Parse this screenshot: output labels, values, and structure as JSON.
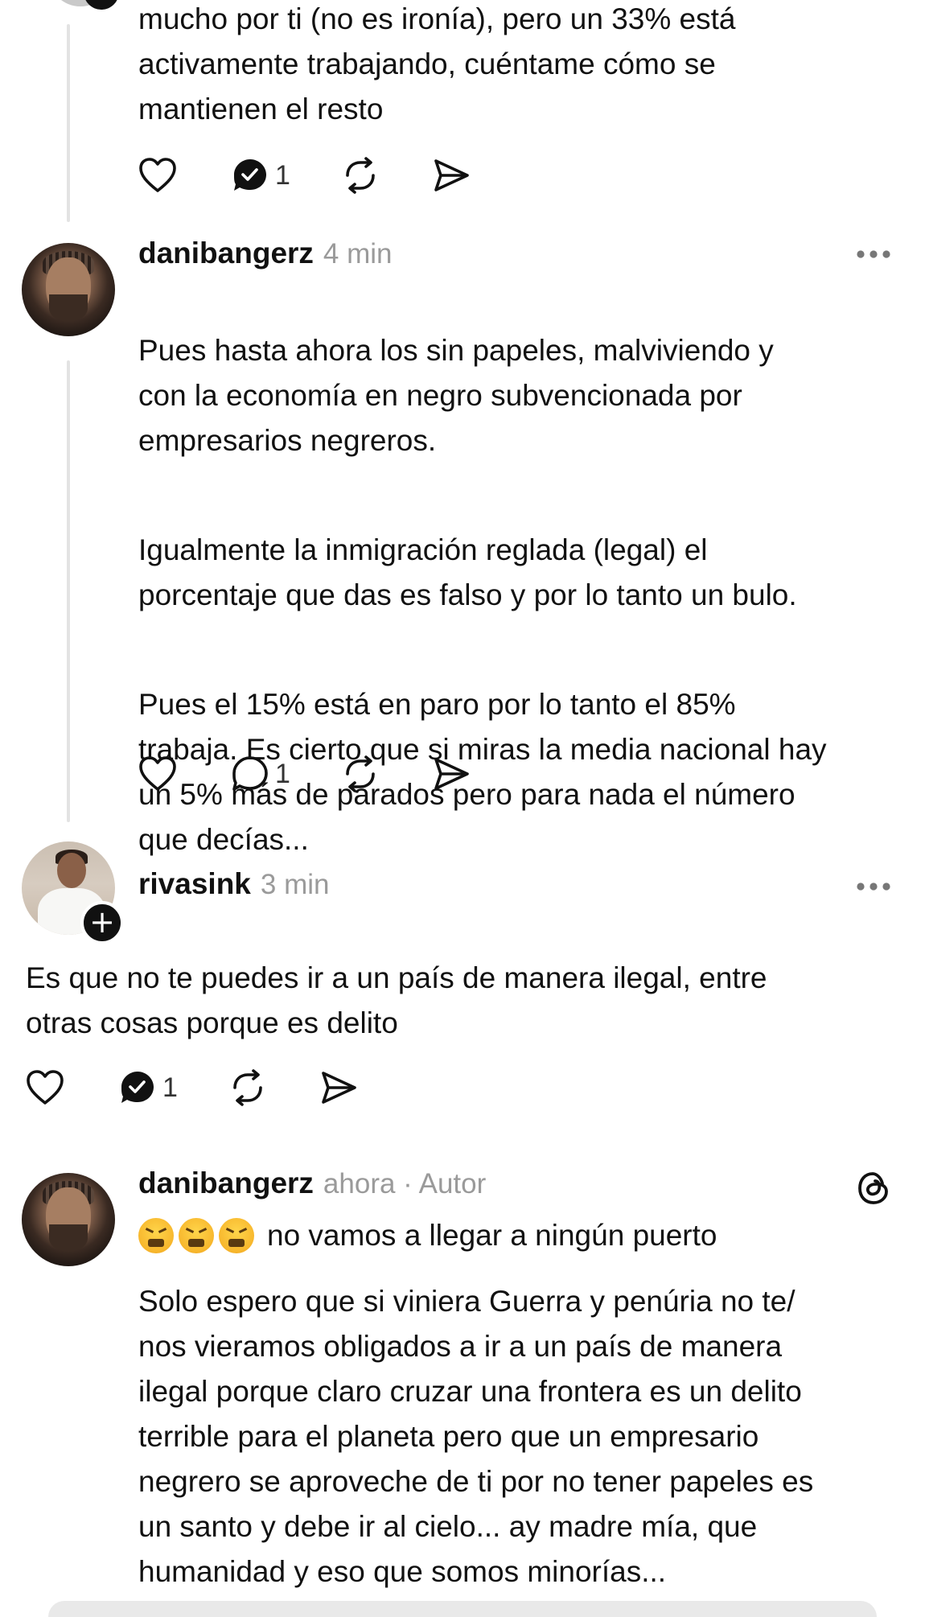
{
  "colors": {
    "text": "#111111",
    "muted": "#9a9a9a",
    "thread_line": "#e3e3e3",
    "background": "#ffffff"
  },
  "posts": [
    {
      "partial": true,
      "text": "mucho por ti (no es ironía), pero un 33% está\nactivamente trabajando, cuéntame cómo se\nmantienen el resto",
      "actions": {
        "like_icon": "heart-icon",
        "reply_icon": "reply-checked-icon",
        "reply_count": "1",
        "repost_icon": "repost-icon",
        "share_icon": "send-icon"
      }
    },
    {
      "username": "danibangerz",
      "time": "4 min",
      "avatar": "avatar-danibangerz",
      "paragraphs": [
        "Pues hasta ahora los sin papeles, malviviendo y\ncon la economía en negro subvencionada por\nempresarios negreros.",
        "Igualmente la inmigración reglada (legal) el\nporcentaje que das es falso y por lo tanto un bulo.",
        "Pues el 15% está en paro por lo tanto el 85%\ntrabaja. Es cierto que si miras la media nacional hay\nun 5% más de parados pero para nada el número\nque decías..."
      ],
      "actions": {
        "like_icon": "heart-icon",
        "reply_icon": "reply-icon",
        "reply_count": "1",
        "repost_icon": "repost-icon",
        "share_icon": "send-icon"
      },
      "more_icon": "more-dots-icon"
    },
    {
      "username": "rivasink",
      "time": "3 min",
      "avatar": "avatar-rivasink",
      "follow_badge": "+",
      "text": "Es que no te puedes ir a un país de manera ilegal, entre\notras cosas porque es delito",
      "actions": {
        "like_icon": "heart-icon",
        "reply_icon": "reply-checked-icon",
        "reply_count": "1",
        "repost_icon": "repost-icon",
        "share_icon": "send-icon"
      },
      "more_icon": "more-dots-icon"
    },
    {
      "username": "danibangerz",
      "time": "ahora · Autor",
      "avatar": "avatar-danibangerz",
      "emoji": "tired-face-emoji",
      "first_line": "no vamos a llegar a ningún puerto",
      "text": "Solo espero que si viniera Guerra y penúria no te/\nnos vieramos obligados a ir a un país de manera\nilegal porque claro cruzar una frontera es un delito\nterrible para el planeta pero que un empresario\nnegrero se aproveche de ti por no tener papeles es\nun santo y debe ir al cielo... ay madre mía, que\nhumanidad y eso que somos minorías...",
      "app_icon": "threads-logo-icon"
    }
  ]
}
